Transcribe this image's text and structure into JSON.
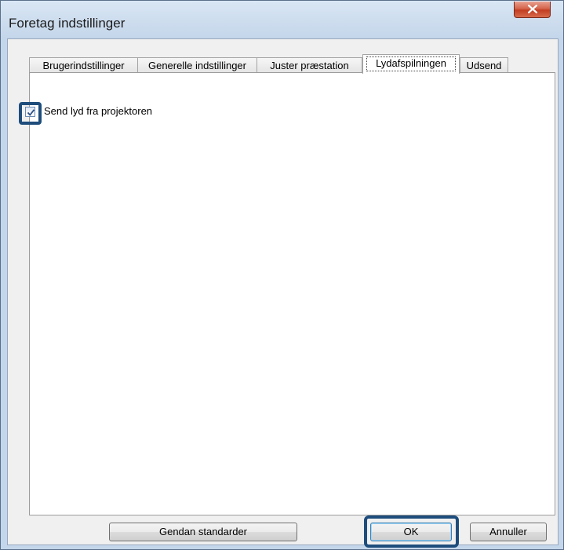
{
  "window": {
    "title": "Foretag indstillinger"
  },
  "tabs": [
    {
      "label": "Brugerindstillinger",
      "active": false
    },
    {
      "label": "Generelle indstillinger",
      "active": false
    },
    {
      "label": "Juster præstation",
      "active": false
    },
    {
      "label": "Lydafspilningen",
      "active": true
    },
    {
      "label": "Udsend",
      "active": false
    }
  ],
  "panel": {
    "checkbox_label": "Send lyd fra projektoren",
    "checkbox_checked": true
  },
  "buttons": {
    "restore_label": "Gendan standarder",
    "ok_label": "OK",
    "cancel_label": "Annuller"
  },
  "colors": {
    "highlight": "#1e4d7c",
    "close_button": "#c23d22"
  },
  "icons": {
    "close": "close-x-icon",
    "checkmark": "checkmark-icon"
  }
}
